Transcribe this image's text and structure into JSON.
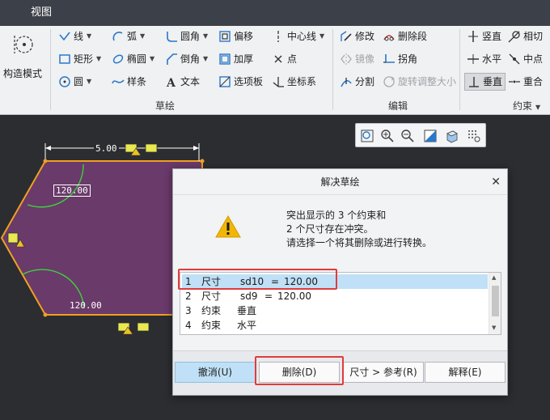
{
  "menubar": {
    "tab_view": "视图"
  },
  "ribbon": {
    "construct_mode": "构造模式",
    "sketch_tools": {
      "line": "线",
      "rect": "矩形",
      "circle": "圆",
      "arc": "弧",
      "ellipse": "椭圆",
      "spline": "样条",
      "fillet": "圆角",
      "chamfer": "倒角",
      "text": "文本",
      "offset": "偏移",
      "thicken": "加厚",
      "palette": "选项板",
      "centerline": "中心线",
      "point": "点",
      "coordsys": "坐标系"
    },
    "edit_tools": {
      "modify": "修改",
      "delete_segment": "删除段",
      "mirror": "镜像",
      "corner": "拐角",
      "divide": "分割",
      "rotate_resize": "旋转调整大小"
    },
    "constraint_tools": {
      "vertical": "竖直",
      "tangent": "相切",
      "horizontal": "水平",
      "midpoint": "中点",
      "perpendicular": "垂直",
      "coincident": "重合"
    },
    "groups": {
      "sketch": "草绘",
      "edit": "编辑",
      "constraint": "约束"
    }
  },
  "sketch": {
    "dim_top": "5.00",
    "dim_angle_top": "120.00",
    "dim_angle_bottom": "120.00"
  },
  "dialog": {
    "title": "解决草绘",
    "message_line1": "突出显示的 3 个约束和",
    "message_line2": "2 个尺寸存在冲突。",
    "message_line3": "请选择一个将其删除或进行转换。",
    "rows": [
      {
        "index": "1",
        "kind": "尺寸",
        "name": "sd10",
        "eq": "=",
        "value": "120.00"
      },
      {
        "index": "2",
        "kind": "尺寸",
        "name": "sd9",
        "eq": "=",
        "value": "120.00"
      },
      {
        "index": "3",
        "kind": "约束",
        "name": "垂直",
        "eq": "",
        "value": ""
      },
      {
        "index": "4",
        "kind": "约束",
        "name": "水平",
        "eq": "",
        "value": ""
      }
    ],
    "buttons": {
      "undo": "撤消(U)",
      "delete": "删除(D)",
      "to_reference": "尺寸 > 参考(R)",
      "explain": "解释(E)"
    }
  },
  "colors": {
    "accent": "#bfe0f6",
    "highlight": "#e23b3b",
    "sketch_fill": "#6a3a6a",
    "sketch_edge": "#f0a020"
  }
}
